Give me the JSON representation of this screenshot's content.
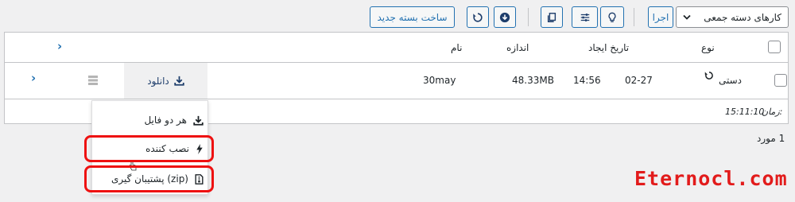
{
  "toolbar": {
    "bulk_select_value": "کارهای دسته جمعی",
    "apply_label": "اجرا",
    "new_package_label": "ساخت بسته جدید"
  },
  "table": {
    "headers": {
      "type": "نوع",
      "created": "تاریخ ایجاد",
      "size": "اندازه",
      "name": "نام"
    },
    "row": {
      "type": "دستی",
      "date": "02-27",
      "time": "14:56",
      "size": "48.33MB",
      "name": "30may",
      "download_label": "دانلود"
    },
    "footer": {
      "time_label": "زمان:",
      "time_value": "15:11:10"
    }
  },
  "count_text": "1 مورد",
  "dropdown_menu": {
    "items": [
      {
        "label": "هر دو فایل",
        "icon": "download-icon"
      },
      {
        "label": "نصب کننده",
        "icon": "bolt-icon"
      },
      {
        "label": "پشتیبان گیری (zip)",
        "icon": "zip-file-icon"
      }
    ]
  },
  "watermark": "Eternocl.com",
  "colors": {
    "accent": "#2271b1",
    "highlight": "#e11111"
  }
}
